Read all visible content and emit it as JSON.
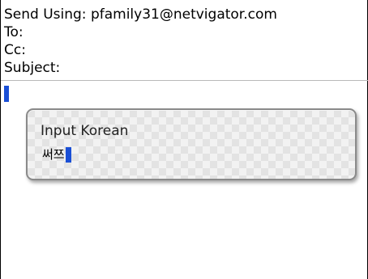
{
  "compose": {
    "send_using_label": "Send Using:",
    "send_using_value": "pfamily31@netvigator.com",
    "to_label": "To:",
    "cc_label": "Cc:",
    "subject_label": "Subject:"
  },
  "input_dialog": {
    "title": "Input Korean",
    "value": "써쯔"
  },
  "colors": {
    "caret": "#1a4fd6"
  }
}
